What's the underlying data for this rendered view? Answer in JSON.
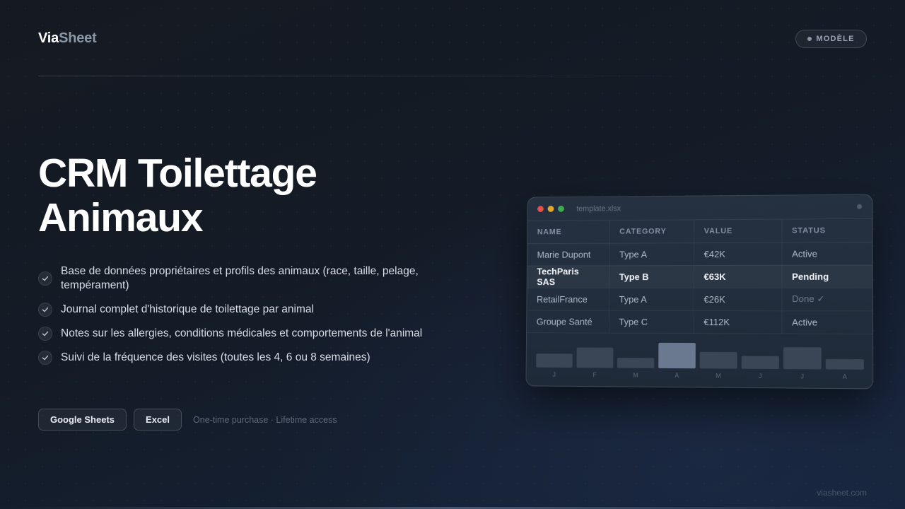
{
  "brand": {
    "part1": "Via",
    "part2": "Sheet"
  },
  "badge": {
    "label": "MODÈLE"
  },
  "hero": {
    "title_line1": "CRM Toilettage",
    "title_line2": "Animaux"
  },
  "features": [
    "Base de données propriétaires et profils des animaux (race, taille, pelage, tempérament)",
    "Journal complet d'historique de toilettage par animal",
    "Notes sur les allergies, conditions médicales et comportements de l'animal",
    "Suivi de la fréquence des visites (toutes les 4, 6 ou 8 semaines)"
  ],
  "buttons": {
    "google_sheets": "Google Sheets",
    "excel": "Excel"
  },
  "purchase_note": "One-time purchase · Lifetime access",
  "footer": "viasheet.com",
  "preview": {
    "filename": "template.xlsx",
    "columns": [
      "NAME",
      "CATEGORY",
      "VALUE",
      "STATUS"
    ],
    "rows": [
      {
        "name": "Marie Dupont",
        "category": "Type A",
        "value": "€42K",
        "status": "Active"
      },
      {
        "name": "TechParis SAS",
        "category": "Type B",
        "value": "€63K",
        "status": "Pending"
      },
      {
        "name": "RetailFrance",
        "category": "Type A",
        "value": "€26K",
        "status": "Done ✓"
      },
      {
        "name": "Groupe Santé",
        "category": "Type C",
        "value": "€112K",
        "status": "Active"
      }
    ],
    "highlighted_row": 1
  },
  "chart_data": {
    "type": "bar",
    "categories": [
      "J",
      "F",
      "M",
      "A",
      "M",
      "J",
      "J",
      "A"
    ],
    "values": [
      0.55,
      0.8,
      0.4,
      1.0,
      0.65,
      0.5,
      0.85,
      0.4
    ],
    "highlighted_index": 3,
    "colors": {
      "bar": "#3a4656",
      "highlight": "#6a7890"
    }
  },
  "colors": {
    "background": "#151b25",
    "accent_muted": "#8a97a8"
  }
}
